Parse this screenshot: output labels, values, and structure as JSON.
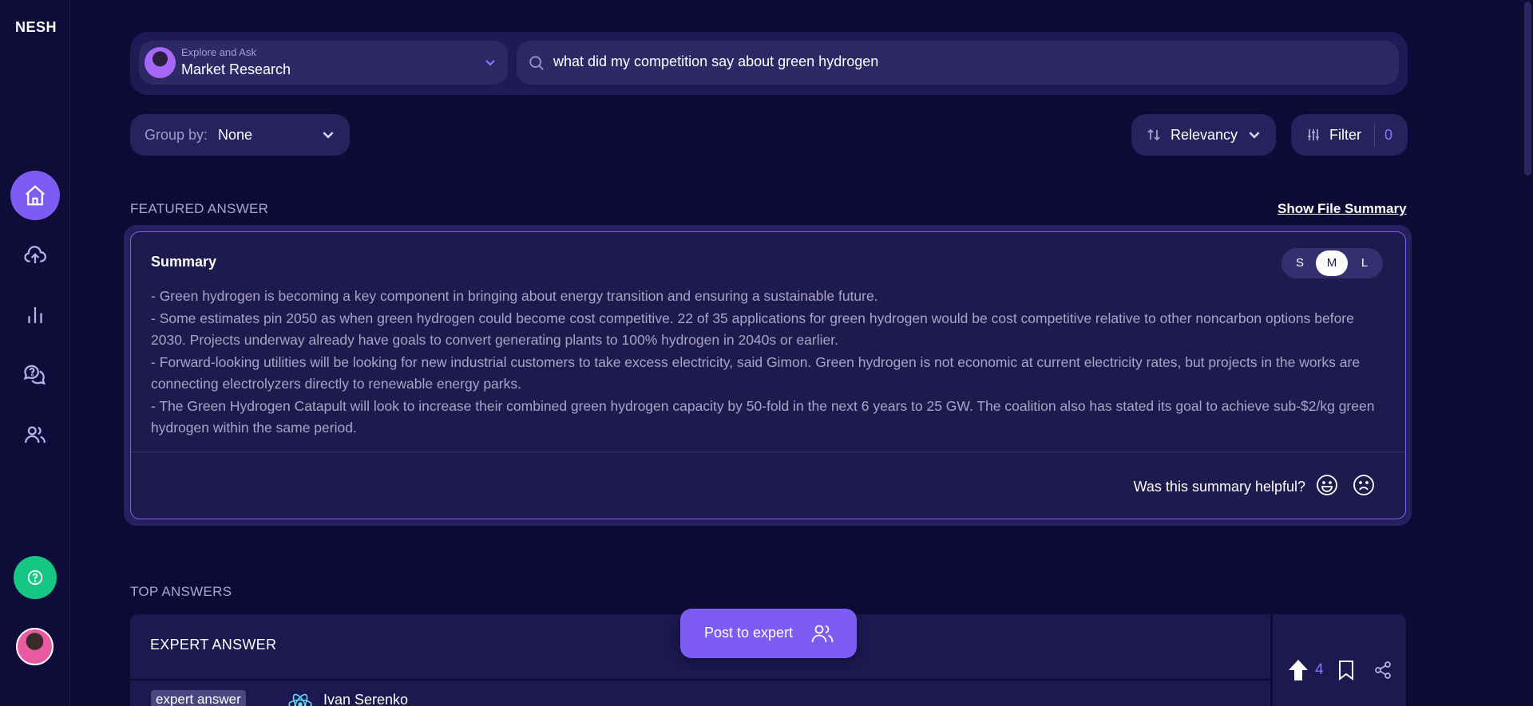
{
  "sidebar": {
    "logo": "NESH",
    "nav": [
      {
        "name": "home",
        "icon": "home-icon",
        "active": true
      },
      {
        "name": "upload",
        "icon": "upload-cloud-icon",
        "active": false
      },
      {
        "name": "analytics",
        "icon": "bar-chart-icon",
        "active": false
      },
      {
        "name": "questions",
        "icon": "chat-question-icon",
        "active": false
      },
      {
        "name": "people",
        "icon": "users-icon",
        "active": false
      }
    ],
    "help_icon": "question-circle-icon"
  },
  "search": {
    "mode_caption": "Explore and Ask",
    "mode_value": "Market Research",
    "query": "what did my competition say about green hydrogen"
  },
  "controls": {
    "group_by_label": "Group by:",
    "group_by_value": "None",
    "sort_value": "Relevancy",
    "filter_label": "Filter",
    "filter_count": "0"
  },
  "featured": {
    "section_label": "FEATURED ANSWER",
    "show_file_summary": "Show File Summary",
    "summary_title": "Summary",
    "sizes": [
      "S",
      "M",
      "L"
    ],
    "selected_size": "M",
    "lines": [
      "- Green hydrogen is becoming a key component in bringing about energy transition and ensuring a sustainable future.",
      "- Some estimates pin 2050 as when green hydrogen could become cost competitive. 22 of 35 applications for green hydrogen would be cost competitive relative to other noncarbon options before 2030. Projects underway already have goals to convert generating plants to 100% hydrogen in 2040s or earlier.",
      "- Forward-looking utilities will be looking for new industrial customers to take excess electricity, said Gimon. Green hydrogen is not economic at current electricity rates, but projects in the works are connecting electrolyzers directly to renewable energy parks.",
      "- The Green Hydrogen Catapult will look to increase their combined green hydrogen capacity by 50-fold in the next 6 years to 25 GW. The coalition also has stated its goal to achieve sub-$2/kg green hydrogen within the same period."
    ],
    "helpful_question": "Was this summary helpful?"
  },
  "top_answers": {
    "section_label": "TOP ANSWERS",
    "card": {
      "title": "EXPERT ANSWER",
      "tag": "expert answer",
      "author": "Ivan Serenko",
      "votes": "4"
    }
  },
  "post_to_expert": "Post to expert",
  "colors": {
    "background": "#0d0b35",
    "accent": "#7c5cf2",
    "help_green": "#16c784"
  }
}
